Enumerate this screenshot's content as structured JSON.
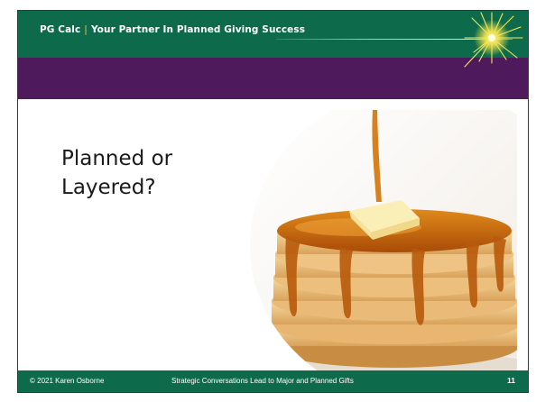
{
  "header": {
    "brand": "PG Calc",
    "separator": "|",
    "tagline": "Your Partner In Planned Giving Success",
    "colors": {
      "green": "#0d6b4c",
      "purple": "#4e1a5c",
      "accent": "#e7c74a"
    }
  },
  "slide": {
    "title_line1": "Planned or",
    "title_line2": "Layered?",
    "image": "pancake-stack-with-syrup-and-butter"
  },
  "footer": {
    "copyright": "© 2021 Karen Osborne",
    "center_text": "Strategic Conversations Lead to Major and Planned Gifts",
    "page_number": "11"
  },
  "icons": {
    "burst": "starburst-icon"
  }
}
